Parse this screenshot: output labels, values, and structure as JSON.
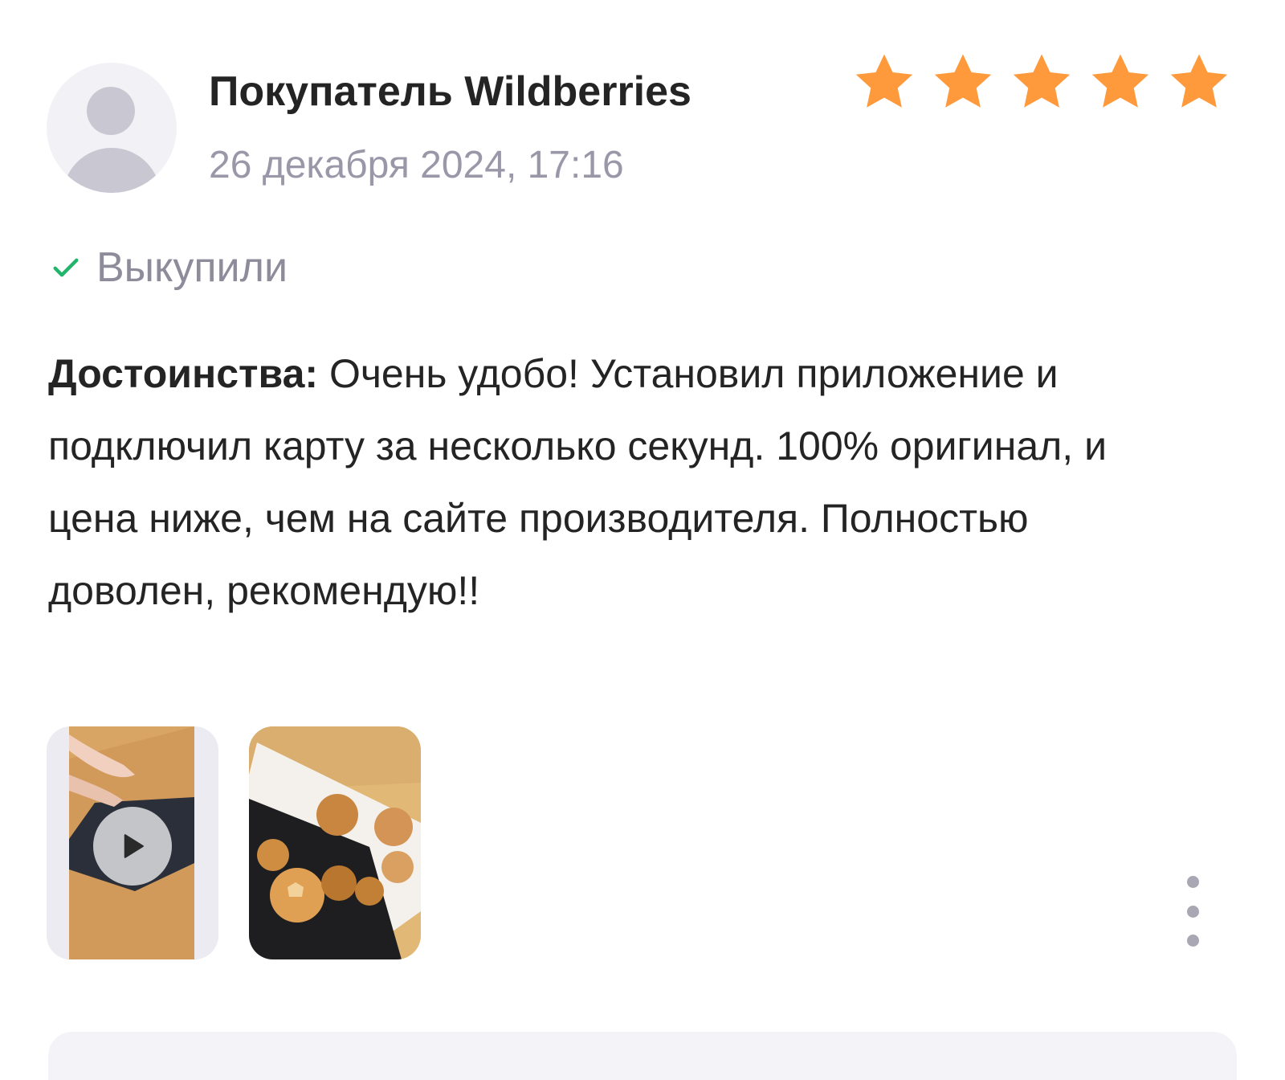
{
  "review": {
    "author": "Покупатель Wildberries",
    "date": "26 декабря 2024, 17:16",
    "rating": 5,
    "rating_max": 5,
    "status": "Выкупили",
    "pros_label": "Достоинства:",
    "pros_text": "Очень удобо! Установил приложение и подключил карту за несколько секунд. 100% оригинал, и цена ниже, чем на сайте производителя. Полностью доволен, рекомендую!!",
    "media": [
      {
        "type": "video",
        "icon": "play-icon"
      },
      {
        "type": "photo"
      }
    ]
  },
  "colors": {
    "star": "#ff9a3c",
    "check": "#1fb56b",
    "muted_text": "#9a97a8",
    "text": "#242424"
  },
  "icons": {
    "avatar": "user-silhouette-icon",
    "status": "check-icon",
    "more": "more-vertical-icon"
  }
}
